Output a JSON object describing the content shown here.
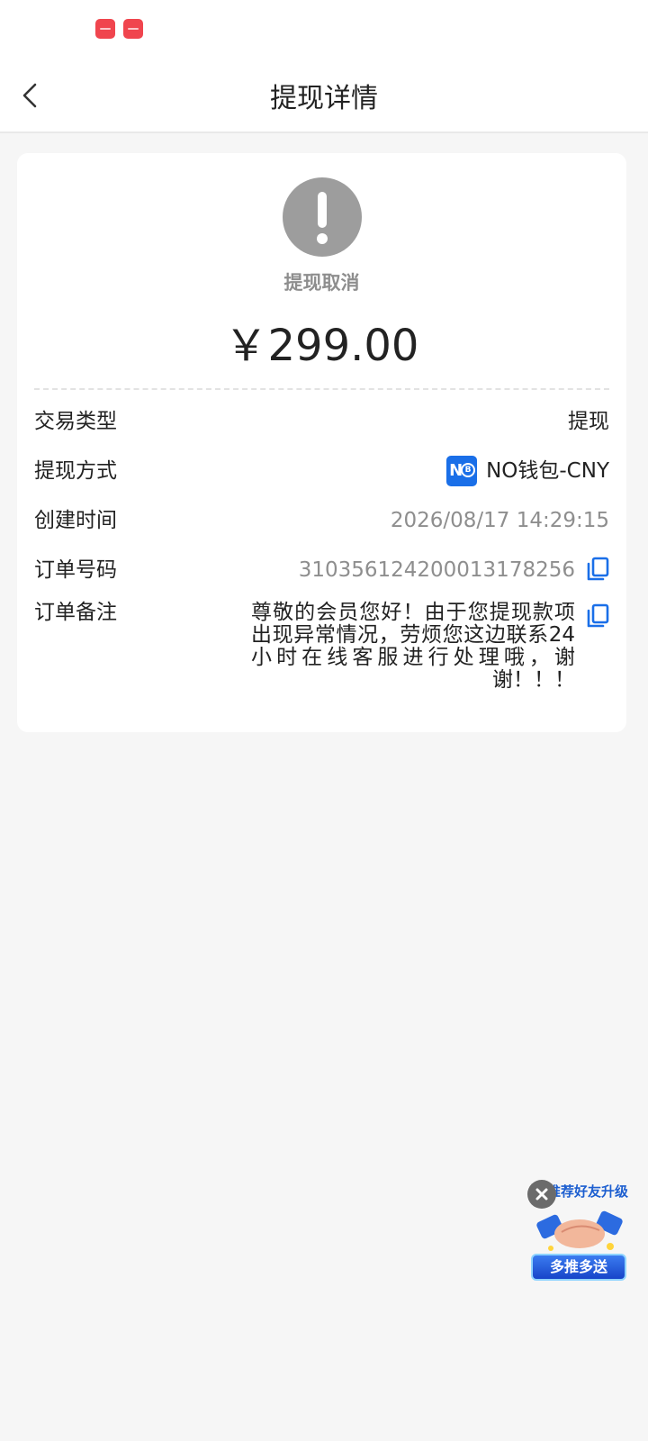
{
  "header": {
    "title": "提现详情"
  },
  "status": {
    "label": "提现取消",
    "amount": "￥299.00"
  },
  "details": {
    "type_label": "交易类型",
    "type_value": "提现",
    "method_label": "提现方式",
    "method_value": "NO钱包-CNY",
    "created_label": "创建时间",
    "created_value": "2026/08/17 14:29:15",
    "order_label": "订单号码",
    "order_value": "310356124200013178256",
    "note_label": "订单备注",
    "note_value": "尊敬的会员您好！由于您提现款项出现异常情况，劳烦您这边联系24小时在线客服进行处理哦，谢谢！！！"
  },
  "promo": {
    "title": "推荐好友升级",
    "button": "多推多送"
  },
  "colors": {
    "accent": "#1a6fe8",
    "status_grey": "#9d9d9d",
    "statusbar_icon": "#f0454e"
  },
  "icons": {
    "back": "chevron-left-icon",
    "status": "exclamation-icon",
    "copy": "copy-icon",
    "close": "close-icon"
  }
}
